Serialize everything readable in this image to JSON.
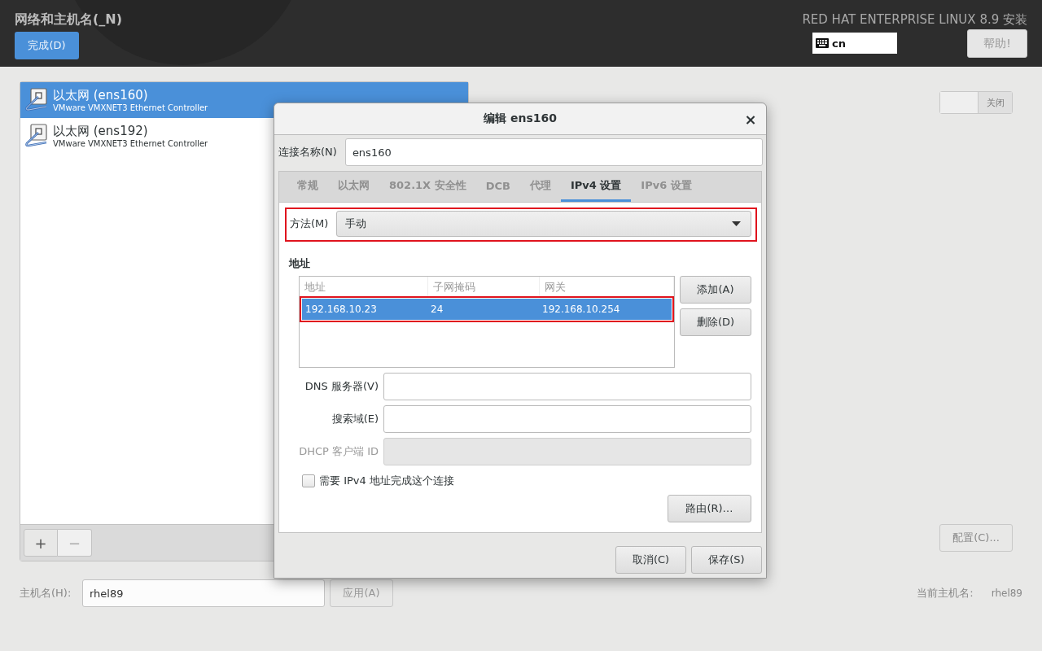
{
  "header": {
    "title": "网络和主机名(_N)",
    "done_button": "完成(D)",
    "product": "RED HAT ENTERPRISE LINUX 8.9 安装",
    "keyboard_layout": "cn",
    "help_button": "帮助!"
  },
  "devices": [
    {
      "name": "以太网 (ens160)",
      "description": "VMware VMXNET3 Ethernet Controller",
      "selected": true
    },
    {
      "name": "以太网 (ens192)",
      "description": "VMware VMXNET3 Ethernet Controller",
      "selected": false
    }
  ],
  "device_toolbar": [
    {
      "label": "+",
      "disabled": false
    },
    {
      "label": "−",
      "disabled": true
    }
  ],
  "detail": {
    "switch": {
      "label": "关闭",
      "on": false
    },
    "configure_button": "配置(C)..."
  },
  "hostname": {
    "label": "主机名(H):",
    "value": "rhel89",
    "apply_button": "应用(A)",
    "current_label": "当前主机名:",
    "current_value": "rhel89"
  },
  "dialog": {
    "title": "编辑 ens160",
    "close": "×",
    "connection_name_label": "连接名称(N)",
    "connection_name": "ens160",
    "tabs": [
      {
        "label": "常规",
        "selected": false
      },
      {
        "label": "以太网",
        "selected": false
      },
      {
        "label": "802.1X 安全性",
        "selected": false
      },
      {
        "label": "DCB",
        "selected": false
      },
      {
        "label": "代理",
        "selected": false
      },
      {
        "label": "IPv4 设置",
        "selected": true
      },
      {
        "label": "IPv6 设置",
        "selected": false
      }
    ],
    "method": {
      "label": "方法(M)",
      "value": "手动",
      "highlighted": true
    },
    "addresses": {
      "title": "地址",
      "columns": [
        "地址",
        "子网掩码",
        "网关"
      ],
      "rows": [
        {
          "cells": [
            "192.168.10.23",
            "24",
            "192.168.10.254"
          ],
          "selected": true,
          "highlighted": true
        }
      ],
      "add_button": "添加(A)",
      "delete_button": "删除(D)"
    },
    "fields": [
      {
        "label": "DNS 服务器(V)",
        "disabled": false
      },
      {
        "label": "搜索域(E)",
        "disabled": false
      },
      {
        "label": "DHCP 客户端 ID",
        "disabled": true
      }
    ],
    "require_ipv4": {
      "label": "需要 IPv4 地址完成这个连接",
      "checked": false
    },
    "routes_button": "路由(R)…",
    "buttons": [
      "取消(C)",
      "保存(S)"
    ]
  }
}
